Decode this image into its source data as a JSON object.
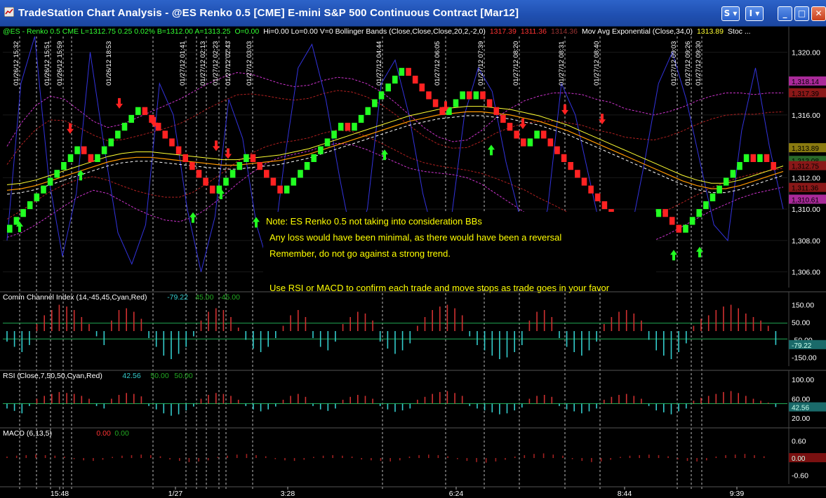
{
  "window": {
    "title": "TradeStation Chart Analysis - @ES Renko 0.5 [CME] E-mini S&P 500 Continuous Contract [Mar12]",
    "btn_s": "S",
    "btn_i": "I",
    "btn_min": "_",
    "btn_max": "□",
    "btn_close": "✕"
  },
  "colors": {
    "up_brick": "#22ff22",
    "down_brick": "#ff2222",
    "cyan": "#33cccc",
    "red": "#d03030",
    "bb_line": "#cc33cc",
    "ema": "#ff9900",
    "yellow": "#ffff33",
    "stoch": "#3333dd",
    "note": "#ffff00",
    "axis_text": "#ffffff"
  },
  "chart_data": [
    {
      "type": "line",
      "panel": "price",
      "header": [
        {
          "text": "@ES - Renko 0.5  CME  L=1312.75  0.25  0.02%  B=1312.00  A=1313.25",
          "color": "#33ff33"
        },
        {
          "text": "O=0.00",
          "color": "#33ff33"
        },
        {
          "text": "Hi=0.00  Lo=0.00  V=0  Bollinger Bands (Close,Close,Close,20,2,-2,0)",
          "color": "#ffffff"
        },
        {
          "text": "1317.39",
          "color": "#ff3333"
        },
        {
          "text": "1311.36",
          "color": "#ff3333"
        },
        {
          "text": "1314.36",
          "color": "#993333"
        },
        {
          "text": "Mov Avg Exponential (Close,34,0)",
          "color": "#ffffff"
        },
        {
          "text": "1313.89",
          "color": "#ffff33"
        },
        {
          "text": "Stoc ...",
          "color": "#ffffff"
        }
      ],
      "ylim": [
        1305.0,
        1321.0
      ],
      "y_ticks": [
        "1,320.00",
        "1,316.00",
        "1,312.00",
        "1,310.00",
        "1,308.00",
        "1,306.00"
      ],
      "y_tick_values": [
        1320,
        1316,
        1312,
        1310,
        1308,
        1306
      ],
      "right_labels": [
        {
          "text": "1,318.14",
          "value": 1318.14,
          "bg": "#aa2a9a"
        },
        {
          "text": "1,317.39",
          "value": 1317.39,
          "bg": "#8a1818"
        },
        {
          "text": "1,313.89",
          "value": 1313.89,
          "bg": "#8a7a10"
        },
        {
          "text": "1,313.08",
          "value": 1313.08,
          "bg": "#2a6a2a"
        },
        {
          "text": "1,312.75",
          "value": 1312.75,
          "bg": "#8a1818"
        },
        {
          "text": "1,311.36",
          "value": 1311.36,
          "bg": "#8a1818"
        },
        {
          "text": "1,310.61",
          "value": 1310.61,
          "bg": "#aa2a9a"
        }
      ],
      "bricks_close": [
        1309.0,
        1309.5,
        1310.0,
        1310.5,
        1311.0,
        1311.5,
        1312.0,
        1312.5,
        1313.0,
        1313.5,
        1314.0,
        1313.5,
        1313.0,
        1313.5,
        1314.0,
        1314.5,
        1315.0,
        1315.5,
        1316.0,
        1316.5,
        1316.0,
        1315.5,
        1315.0,
        1314.5,
        1314.0,
        1313.5,
        1313.0,
        1312.5,
        1312.0,
        1311.5,
        1311.0,
        1311.5,
        1312.0,
        1312.5,
        1313.0,
        1313.5,
        1313.0,
        1312.5,
        1312.0,
        1311.5,
        1311.0,
        1311.5,
        1312.0,
        1312.5,
        1313.0,
        1313.5,
        1314.0,
        1314.5,
        1315.0,
        1315.5,
        1315.0,
        1315.5,
        1316.0,
        1316.5,
        1317.0,
        1317.5,
        1318.0,
        1318.5,
        1319.0,
        1318.5,
        1318.0,
        1317.5,
        1317.0,
        1316.5,
        1316.0,
        1316.5,
        1317.0,
        1317.5,
        1317.0,
        1317.5,
        1317.0,
        1316.5,
        1316.0,
        1315.5,
        1315.0,
        1314.5,
        1314.0,
        1314.5,
        1315.0,
        1314.5,
        1314.0,
        1313.5,
        1313.0,
        1312.5,
        1312.0,
        1311.5,
        1311.0,
        1310.5,
        1310.0,
        1309.5,
        1309.0,
        1308.5,
        1308.0,
        1308.5,
        1309.0,
        1309.5,
        1310.0,
        1309.5,
        1309.0,
        1308.5,
        1309.0,
        1309.5,
        1310.0,
        1310.5,
        1311.0,
        1311.5,
        1312.0,
        1312.5,
        1313.0,
        1313.5,
        1313.0,
        1313.5,
        1313.0,
        1312.5
      ],
      "ema34": [
        1311.2,
        1311.3,
        1311.5,
        1311.8,
        1312.1,
        1312.4,
        1312.7,
        1313.0,
        1313.2,
        1313.3,
        1313.3,
        1313.2,
        1313.1,
        1313.0,
        1312.9,
        1312.8,
        1312.8,
        1312.9,
        1313.0,
        1313.1,
        1313.3,
        1313.5,
        1313.8,
        1314.1,
        1314.4,
        1314.7,
        1315.0,
        1315.3,
        1315.6,
        1315.8,
        1316.0,
        1316.1,
        1316.2,
        1316.2,
        1316.1,
        1316.0,
        1315.8,
        1315.6,
        1315.3,
        1315.0,
        1314.6,
        1314.2,
        1313.8,
        1313.4,
        1313.0,
        1312.6,
        1312.2,
        1311.8,
        1311.5,
        1311.3,
        1311.3,
        1311.5,
        1311.8,
        1312.1,
        1312.4
      ],
      "bb_upper": [
        1314.0,
        1315.5,
        1316.6,
        1317.2,
        1317.0,
        1316.3,
        1315.6,
        1315.2,
        1315.4,
        1315.8,
        1316.2,
        1316.6,
        1317.0,
        1317.5,
        1318.0,
        1318.4,
        1318.7,
        1318.6,
        1318.3,
        1318.0,
        1317.8,
        1317.9,
        1318.2,
        1318.4,
        1318.3,
        1318.0,
        1317.5,
        1316.8,
        1316.0,
        1315.2,
        1314.6,
        1314.3,
        1314.4,
        1315.0,
        1315.8,
        1316.4,
        1316.9,
        1317.2,
        1317.4,
        1317.4,
        1317.3,
        1317.0,
        1316.8,
        1316.4,
        1316.2,
        1316.0,
        1316.2,
        1316.5,
        1316.9,
        1317.2,
        1317.4,
        1317.4,
        1317.3,
        1317.4,
        1317.4
      ],
      "bb_lower": [
        1308.2,
        1308.5,
        1309.0,
        1309.6,
        1310.2,
        1310.8,
        1311.2,
        1311.0,
        1310.5,
        1310.0,
        1309.6,
        1309.3,
        1309.2,
        1309.5,
        1310.1,
        1310.8,
        1311.6,
        1312.3,
        1312.9,
        1313.3,
        1313.5,
        1313.7,
        1314.0,
        1314.2,
        1314.1,
        1313.8,
        1313.4,
        1313.0,
        1312.6,
        1312.4,
        1312.3,
        1312.2,
        1312.0,
        1311.6,
        1311.0,
        1310.4,
        1309.8,
        1309.1,
        1308.5,
        1307.9,
        1307.5,
        1307.2,
        1307.1,
        1307.3,
        1307.6,
        1308.0,
        1308.4,
        1308.9,
        1309.4,
        1309.9,
        1310.3,
        1310.7,
        1311.0,
        1311.2,
        1311.4
      ],
      "stoch_osc": [
        1308.0,
        1318.0,
        1321.0,
        1312.0,
        1307.0,
        1311.0,
        1320.0,
        1314.0,
        1308.5,
        1306.5,
        1309.0,
        1318.0,
        1316.0,
        1310.0,
        1306.0,
        1309.5,
        1317.0,
        1314.5,
        1309.0,
        1306.0,
        1313.0,
        1319.0,
        1320.5,
        1317.0,
        1312.0,
        1307.5,
        1310.0,
        1318.0,
        1319.5,
        1316.0,
        1311.0,
        1307.5,
        1309.0,
        1316.0,
        1319.0,
        1317.5,
        1313.0,
        1309.5,
        1307.0,
        1310.0,
        1318.0,
        1316.0,
        1312.0,
        1308.0,
        1306.5,
        1308.5,
        1313.0,
        1318.0,
        1320.0,
        1317.0,
        1313.0,
        1309.0,
        1308.0,
        1315.0,
        1319.0,
        1314.0,
        1310.0
      ],
      "vlines_x": [
        28,
        52,
        72,
        90,
        102,
        218,
        265,
        280,
        294,
        312,
        322,
        360,
        545,
        635,
        690,
        740,
        805,
        855,
        965,
        985,
        1000
      ],
      "time_labels": [
        {
          "x": 28,
          "text": "01/26/12 15:32"
        },
        {
          "x": 72,
          "text": "01/26/12 15:51"
        },
        {
          "x": 90,
          "text": "01/26/12 15:59"
        },
        {
          "x": 160,
          "text": "01/26/12 18:53"
        },
        {
          "x": 265,
          "text": "01/27/12 01:41"
        },
        {
          "x": 294,
          "text": "01/27/12 02:13"
        },
        {
          "x": 312,
          "text": "01/27/12 02:23"
        },
        {
          "x": 330,
          "text": "01/27/12 02:43"
        },
        {
          "x": 360,
          "text": "01/27/12 03:03"
        },
        {
          "x": 545,
          "text": "01/27/12 04:44"
        },
        {
          "x": 628,
          "text": "01/27/12 06:05"
        },
        {
          "x": 690,
          "text": "01/27/12 07:39"
        },
        {
          "x": 740,
          "text": "01/27/12 08:20"
        },
        {
          "x": 805,
          "text": "01/27/12 08:31"
        },
        {
          "x": 855,
          "text": "01/27/12 08:40"
        },
        {
          "x": 965,
          "text": "01/27/12 09:03"
        },
        {
          "x": 985,
          "text": "01/27/12 09:26"
        },
        {
          "x": 1000,
          "text": "01/27/12 09:30"
        }
      ],
      "buy_signals": [
        [
          28,
          1309.2
        ],
        [
          115,
          1312.5
        ],
        [
          275,
          1309.8
        ],
        [
          315,
          1311.3
        ],
        [
          365,
          1309.5
        ],
        [
          548,
          1313.8
        ],
        [
          700,
          1314.1
        ],
        [
          960,
          1307.4
        ],
        [
          997,
          1307.6
        ]
      ],
      "sell_signals": [
        [
          100,
          1314.8
        ],
        [
          170,
          1316.4
        ],
        [
          220,
          1315.2
        ],
        [
          308,
          1313.7
        ],
        [
          325,
          1313.2
        ],
        [
          635,
          1316.2
        ],
        [
          745,
          1315.1
        ],
        [
          805,
          1316.0
        ],
        [
          858,
          1315.4
        ]
      ],
      "notes": [
        "Note: ES Renko 0.5 not taking into consideration BBs",
        "Any loss would have been minimal, as there would have been a reversal",
        "Remember, do not go against a strong trend.",
        "Use RSI or MACD to confirm each trade and move stops as trade goes in your favor"
      ]
    },
    {
      "type": "bar",
      "panel": "cci",
      "label": "Comm Channel Index (14,-45,45,Cyan,Red)",
      "value_text": "-79.22",
      "level_texts": [
        "45.00",
        "-45.00"
      ],
      "ylim": [
        -200,
        200
      ],
      "y_ticks": [
        "150.00",
        "50.00",
        "-50.00",
        "-150.00"
      ],
      "y_tick_values": [
        150,
        50,
        -50,
        -150
      ],
      "current_label": "-79.22",
      "current_value": -79.22,
      "levels": [
        45,
        -45
      ],
      "values": [
        -60,
        -90,
        -120,
        -80,
        40,
        90,
        120,
        150,
        140,
        120,
        80,
        40,
        -30,
        -80,
        60,
        120,
        130,
        110,
        70,
        -40,
        -90,
        -140,
        -160,
        -130,
        -90,
        -30,
        60,
        110,
        130,
        120,
        80,
        20,
        -50,
        -100,
        -120,
        -90,
        -40,
        30,
        90,
        120,
        80,
        -40,
        -90,
        -110,
        -60,
        40,
        80,
        110,
        100,
        60,
        -60,
        -100,
        -130,
        -110,
        -70,
        30,
        80,
        120,
        140,
        150,
        130,
        90,
        -30,
        -80,
        -110,
        -140,
        -160,
        -150,
        -120,
        -80,
        60,
        110,
        120,
        80,
        -40,
        -90,
        -120,
        -140,
        -110,
        -60,
        40,
        80,
        110,
        120,
        100,
        60,
        -50,
        -110,
        -140,
        -160,
        -120,
        -70,
        30,
        70,
        90,
        120,
        140,
        150,
        130,
        100,
        80,
        60,
        30,
        -79
      ]
    },
    {
      "type": "bar",
      "panel": "rsi",
      "label": "RSI (Close,7,50,50,Cyan,Red)",
      "value_text": "42.56",
      "level_texts": [
        "50.00",
        "50.00"
      ],
      "ylim": [
        0,
        110
      ],
      "y_ticks": [
        "100.00",
        "60.00",
        "20.00"
      ],
      "y_tick_values": [
        100,
        60,
        20
      ],
      "current_label": "42.56",
      "current_value": 42.56,
      "levels": [
        50
      ],
      "values": [
        40,
        35,
        30,
        45,
        60,
        66,
        70,
        74,
        72,
        70,
        66,
        60,
        45,
        40,
        60,
        68,
        72,
        70,
        65,
        45,
        38,
        30,
        25,
        28,
        36,
        44,
        60,
        68,
        72,
        70,
        66,
        58,
        45,
        38,
        34,
        38,
        44,
        58,
        66,
        70,
        64,
        45,
        38,
        35,
        40,
        58,
        64,
        68,
        66,
        60,
        45,
        38,
        33,
        36,
        40,
        58,
        64,
        70,
        74,
        76,
        72,
        66,
        45,
        40,
        36,
        32,
        28,
        30,
        36,
        42,
        60,
        66,
        68,
        64,
        45,
        38,
        34,
        30,
        34,
        40,
        58,
        64,
        68,
        70,
        66,
        60,
        45,
        36,
        32,
        28,
        34,
        40,
        56,
        62,
        66,
        70,
        74,
        76,
        72,
        66,
        60,
        56,
        52,
        43
      ]
    },
    {
      "type": "bar",
      "panel": "macd",
      "label": "MACD (6,13,5)",
      "value_texts": [
        "0.00",
        "0.00"
      ],
      "ylim": [
        -0.9,
        0.9
      ],
      "y_ticks": [
        "0.60",
        "-0.60"
      ],
      "y_tick_values": [
        0.6,
        -0.6
      ],
      "current_label": "0.00",
      "current_value": 0.0,
      "values": [
        0.05,
        0.08,
        0.1,
        0.12,
        0.1,
        0.08,
        0.05,
        -0.04,
        -0.08,
        -0.1,
        -0.06,
        0.04,
        0.08,
        0.1,
        0.12,
        0.1,
        0.06,
        -0.05,
        -0.1,
        -0.14,
        -0.12,
        -0.08,
        0.04,
        0.08,
        0.12,
        0.14,
        0.1,
        0.06,
        -0.04,
        -0.08,
        -0.1,
        -0.06,
        0.04,
        0.08,
        0.1,
        0.08,
        0.05,
        -0.05,
        -0.08,
        -0.1,
        -0.12,
        -0.08,
        0.05,
        0.1,
        0.12,
        0.1,
        0.06,
        -0.04,
        -0.1,
        -0.14,
        -0.16,
        -0.12,
        -0.06,
        0.05,
        0.1,
        0.14,
        0.16,
        0.12,
        0.08,
        -0.04,
        -0.1,
        -0.14,
        -0.12,
        -0.06,
        0.04,
        0.08,
        0.1,
        0.12,
        0.1,
        0.06,
        -0.05,
        -0.1,
        -0.12,
        -0.08,
        0.05,
        0.1,
        0.12,
        0.14,
        0.1,
        0.06,
        0.0
      ]
    }
  ],
  "x_axis": {
    "labels": [
      {
        "x": 85,
        "text": "15:48"
      },
      {
        "x": 250,
        "text": "1/27"
      },
      {
        "x": 410,
        "text": "3:28"
      },
      {
        "x": 650,
        "text": "6:24"
      },
      {
        "x": 890,
        "text": "8:44"
      },
      {
        "x": 1050,
        "text": "9:39"
      }
    ]
  }
}
